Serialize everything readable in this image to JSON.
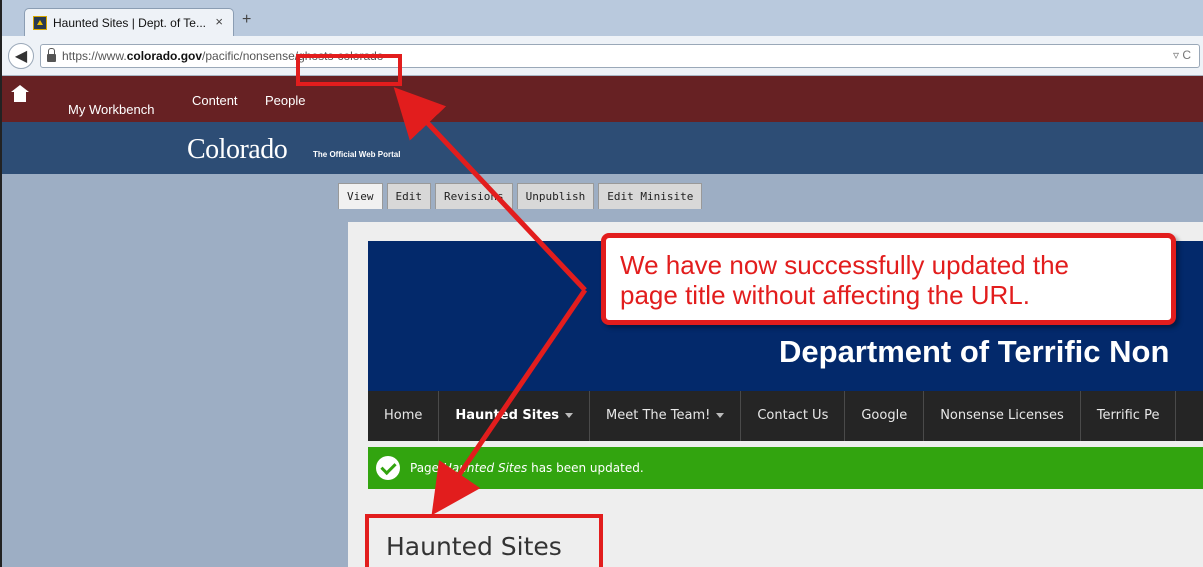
{
  "browser": {
    "tab_title": "Haunted Sites | Dept. of Te...",
    "tab_close": "×",
    "new_tab": "+",
    "url_prefix": "https://www.",
    "url_domain": "colorado.gov",
    "url_path_mid": "/pacific/nonsense",
    "url_slug": "/ghosts-colorado",
    "url_tools": "▿ C"
  },
  "admin_toolbar": {
    "my_workbench": "My Workbench",
    "content": "Content",
    "people": "People"
  },
  "site_header": {
    "brand": "Colorado",
    "tagline": "The Official Web Portal"
  },
  "local_tabs": [
    "View",
    "Edit",
    "Revisions",
    "Unpublish",
    "Edit Minisite"
  ],
  "page": {
    "department": "Department of Terrific Non",
    "nav": [
      {
        "label": "Home",
        "dropdown": false,
        "bold": false
      },
      {
        "label": "Haunted Sites",
        "dropdown": true,
        "bold": true
      },
      {
        "label": "Meet The Team!",
        "dropdown": true,
        "bold": false
      },
      {
        "label": "Contact Us",
        "dropdown": false,
        "bold": false
      },
      {
        "label": "Google",
        "dropdown": false,
        "bold": false
      },
      {
        "label": "Nonsense Licenses",
        "dropdown": false,
        "bold": false
      },
      {
        "label": "Terrific Pe",
        "dropdown": false,
        "bold": false
      }
    ],
    "status_prefix": "Page ",
    "status_title": "Haunted Sites",
    "status_suffix": " has been updated.",
    "title": "Haunted Sites"
  },
  "annotation": {
    "callout_line1": "We have now successfully updated the",
    "callout_line2": "page title without affecting the URL.",
    "accent_color": "#e21d1d"
  },
  "colors": {
    "admin_bar": "#672123",
    "site_header": "#2d4d75",
    "banner": "#03296b",
    "status_green": "#32a40f"
  }
}
